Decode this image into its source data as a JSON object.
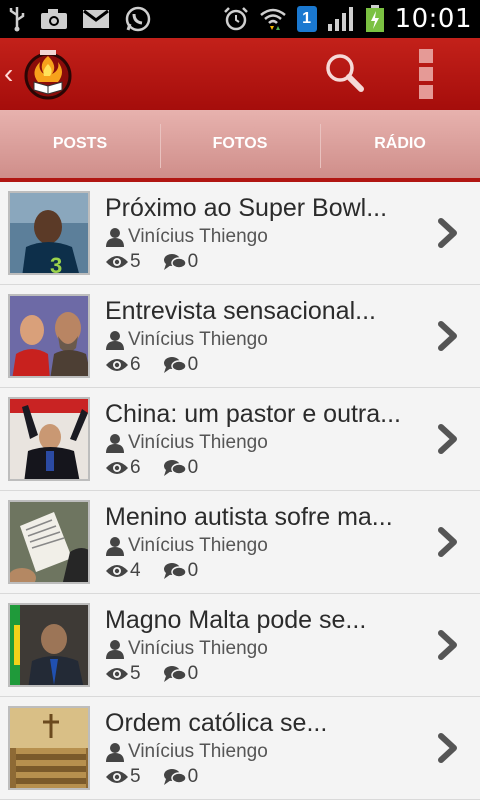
{
  "status_bar": {
    "time": "10:01",
    "sim_slot": "1"
  },
  "tabs": [
    {
      "label": "POSTS"
    },
    {
      "label": "FOTOS"
    },
    {
      "label": "RÁDIO"
    }
  ],
  "posts": [
    {
      "title": "Próximo ao Super Bowl...",
      "author": "Vinícius Thiengo",
      "views": "5",
      "comments": "0"
    },
    {
      "title": "Entrevista sensacional...",
      "author": "Vinícius Thiengo",
      "views": "6",
      "comments": "0"
    },
    {
      "title": "China: um pastor e outra...",
      "author": "Vinícius Thiengo",
      "views": "6",
      "comments": "0"
    },
    {
      "title": "Menino autista sofre ma...",
      "author": "Vinícius Thiengo",
      "views": "4",
      "comments": "0"
    },
    {
      "title": "Magno Malta pode se...",
      "author": "Vinícius Thiengo",
      "views": "5",
      "comments": "0"
    },
    {
      "title": "Ordem católica se...",
      "author": "Vinícius Thiengo",
      "views": "5",
      "comments": "0"
    }
  ],
  "colors": {
    "action_bar": "#b5140f",
    "tab_bg": "#d99995",
    "tab_indicator": "#b11612"
  }
}
